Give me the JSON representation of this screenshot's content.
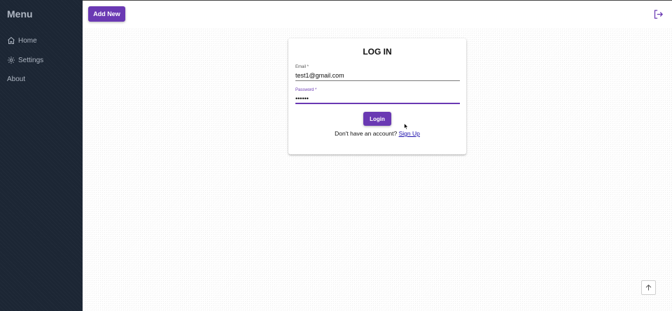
{
  "sidebar": {
    "title": "Menu",
    "items": [
      {
        "label": "Home",
        "icon": "home-icon"
      },
      {
        "label": "Settings",
        "icon": "gear-icon"
      },
      {
        "label": "About"
      }
    ]
  },
  "header": {
    "add_label": "Add New",
    "logout_icon": "logout-icon"
  },
  "login": {
    "title": "LOG IN",
    "email": {
      "label": "Email *",
      "value": "test1@gmail.com"
    },
    "password": {
      "label": "Password *",
      "value": "••••••"
    },
    "submit_label": "Login",
    "signup_prompt": "Don't have an account?",
    "signup_link": "Sign Up"
  },
  "colors": {
    "accent": "#6a39b3",
    "sidebar_bg": "#1c2634",
    "link": "#1a0dab"
  }
}
